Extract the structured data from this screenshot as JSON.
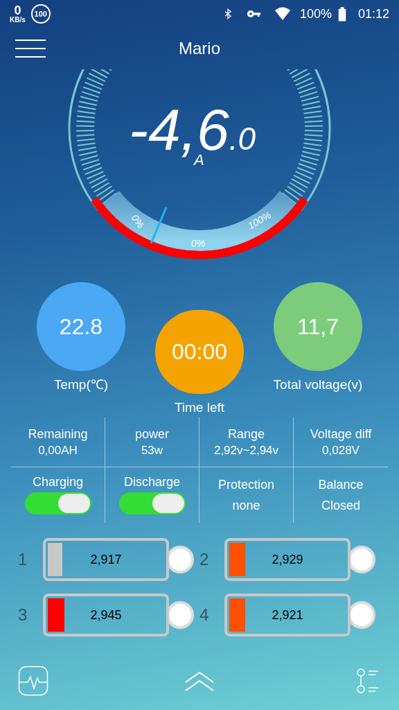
{
  "status_bar": {
    "net_speed": "0",
    "net_unit": "KB/s",
    "badge": "100",
    "battery": "100%",
    "time": "01:12"
  },
  "header": {
    "title": "Mario"
  },
  "gauge": {
    "value": "-4,6",
    "decimal": ".0",
    "unit": "A",
    "labels": [
      "0%",
      "0%",
      "100%"
    ]
  },
  "circles": [
    {
      "value": "22.8",
      "label": "Temp(℃)",
      "color": "#4aa8f5"
    },
    {
      "value": "00:00",
      "label": "Time left",
      "color": "#f5a300"
    },
    {
      "value": "11,7",
      "label": "Total voltage(v)",
      "color": "#7ccc7c"
    }
  ],
  "stats": [
    {
      "label": "Remaining",
      "value": "0,00AH"
    },
    {
      "label": "power",
      "value": "53w"
    },
    {
      "label": "Range",
      "value": "2,92v~2,94v"
    },
    {
      "label": "Voltage diff",
      "value": "0,028V"
    }
  ],
  "controls": [
    {
      "kind": "toggle",
      "label": "Charging",
      "on": true
    },
    {
      "kind": "toggle",
      "label": "Discharge",
      "on": true
    },
    {
      "kind": "text",
      "label": "Protection",
      "value": "none"
    },
    {
      "kind": "text",
      "label": "Balance",
      "value": "Closed"
    }
  ],
  "cells": [
    {
      "index": "1",
      "value": "2,917",
      "level": 0.12,
      "color": "#c8c8c8"
    },
    {
      "index": "2",
      "value": "2,929",
      "level": 0.13,
      "color": "#ff5000"
    },
    {
      "index": "3",
      "value": "2,945",
      "level": 0.14,
      "color": "#ff0000"
    },
    {
      "index": "4",
      "value": "2,921",
      "level": 0.13,
      "color": "#ff5000"
    }
  ]
}
